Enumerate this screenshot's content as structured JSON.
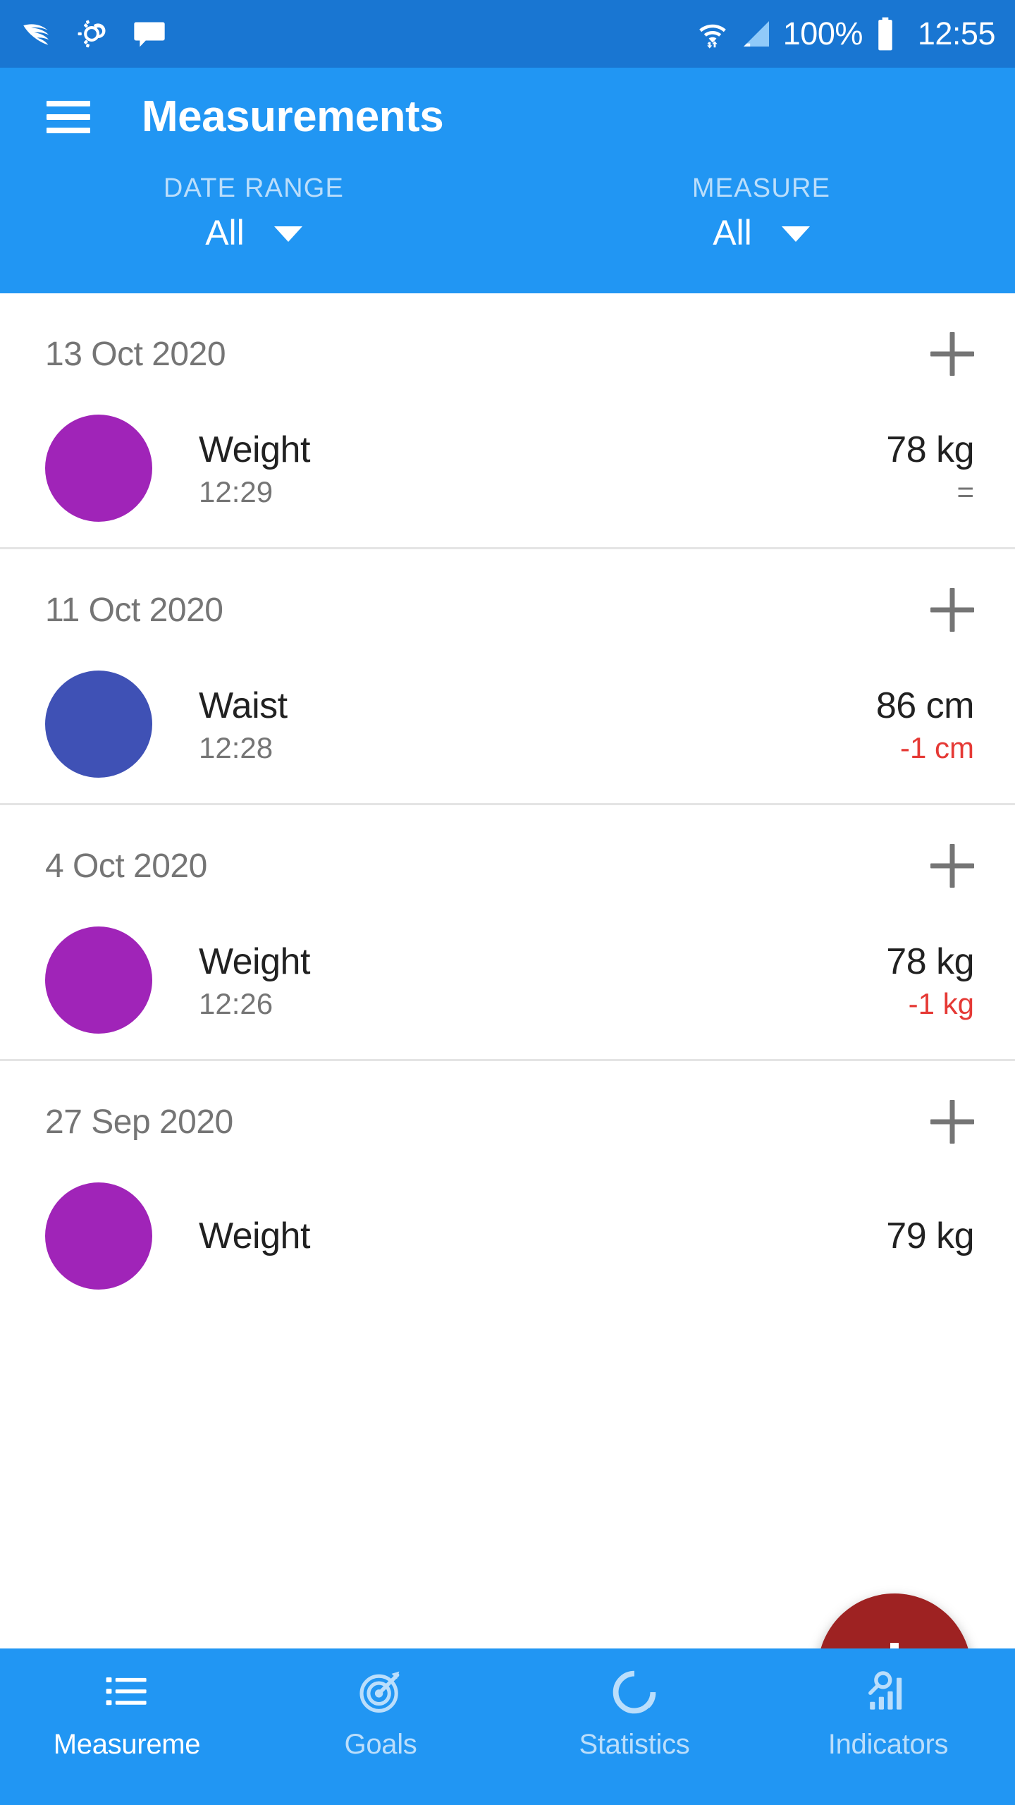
{
  "status_bar": {
    "left_icons": [
      "swiftkey-icon",
      "weather-icon",
      "message-icon"
    ],
    "wifi_icon": "wifi-icon",
    "signal_icon": "signal-icon",
    "battery_percent": "100%",
    "battery_icon": "battery-icon",
    "time": "12:55",
    "background": "#1976D2"
  },
  "app_bar": {
    "menu_icon": "hamburger-menu-icon",
    "title": "Measurements",
    "background": "#2196F3",
    "filters": [
      {
        "label": "DATE RANGE",
        "value": "All",
        "caret": "chevron-down-icon"
      },
      {
        "label": "MEASURE",
        "value": "All",
        "caret": "chevron-down-icon"
      }
    ]
  },
  "list": {
    "groups": [
      {
        "date": "13 Oct 2020",
        "add_icon": "plus-icon",
        "entries": [
          {
            "color": "#A024B8",
            "name": "Weight",
            "time": "12:29",
            "value": "78 kg",
            "delta": "=",
            "delta_kind": "same"
          }
        ]
      },
      {
        "date": "11 Oct 2020",
        "add_icon": "plus-icon",
        "entries": [
          {
            "color": "#3F51B5",
            "name": "Waist",
            "time": "12:28",
            "value": "86 cm",
            "delta": "-1 cm",
            "delta_kind": "down"
          }
        ]
      },
      {
        "date": "4 Oct 2020",
        "add_icon": "plus-icon",
        "entries": [
          {
            "color": "#A024B8",
            "name": "Weight",
            "time": "12:26",
            "value": "78 kg",
            "delta": "-1 kg",
            "delta_kind": "down"
          }
        ]
      },
      {
        "date": "27 Sep 2020",
        "add_icon": "plus-icon",
        "entries": [
          {
            "color": "#A024B8",
            "name": "Weight",
            "time": "",
            "value": "79 kg",
            "delta": "",
            "delta_kind": "none"
          }
        ]
      }
    ]
  },
  "fab": {
    "icon": "plus-icon",
    "color": "#9E2222"
  },
  "bottom_nav": {
    "items": [
      {
        "label": "Measureme",
        "icon": "list-icon",
        "active": true
      },
      {
        "label": "Goals",
        "icon": "target-icon",
        "active": false
      },
      {
        "label": "Statistics",
        "icon": "donut-chart-icon",
        "active": false
      },
      {
        "label": "Indicators",
        "icon": "analytics-icon",
        "active": false
      }
    ],
    "active_color": "#FFFFFF",
    "inactive_color": "#BBDEFB"
  }
}
